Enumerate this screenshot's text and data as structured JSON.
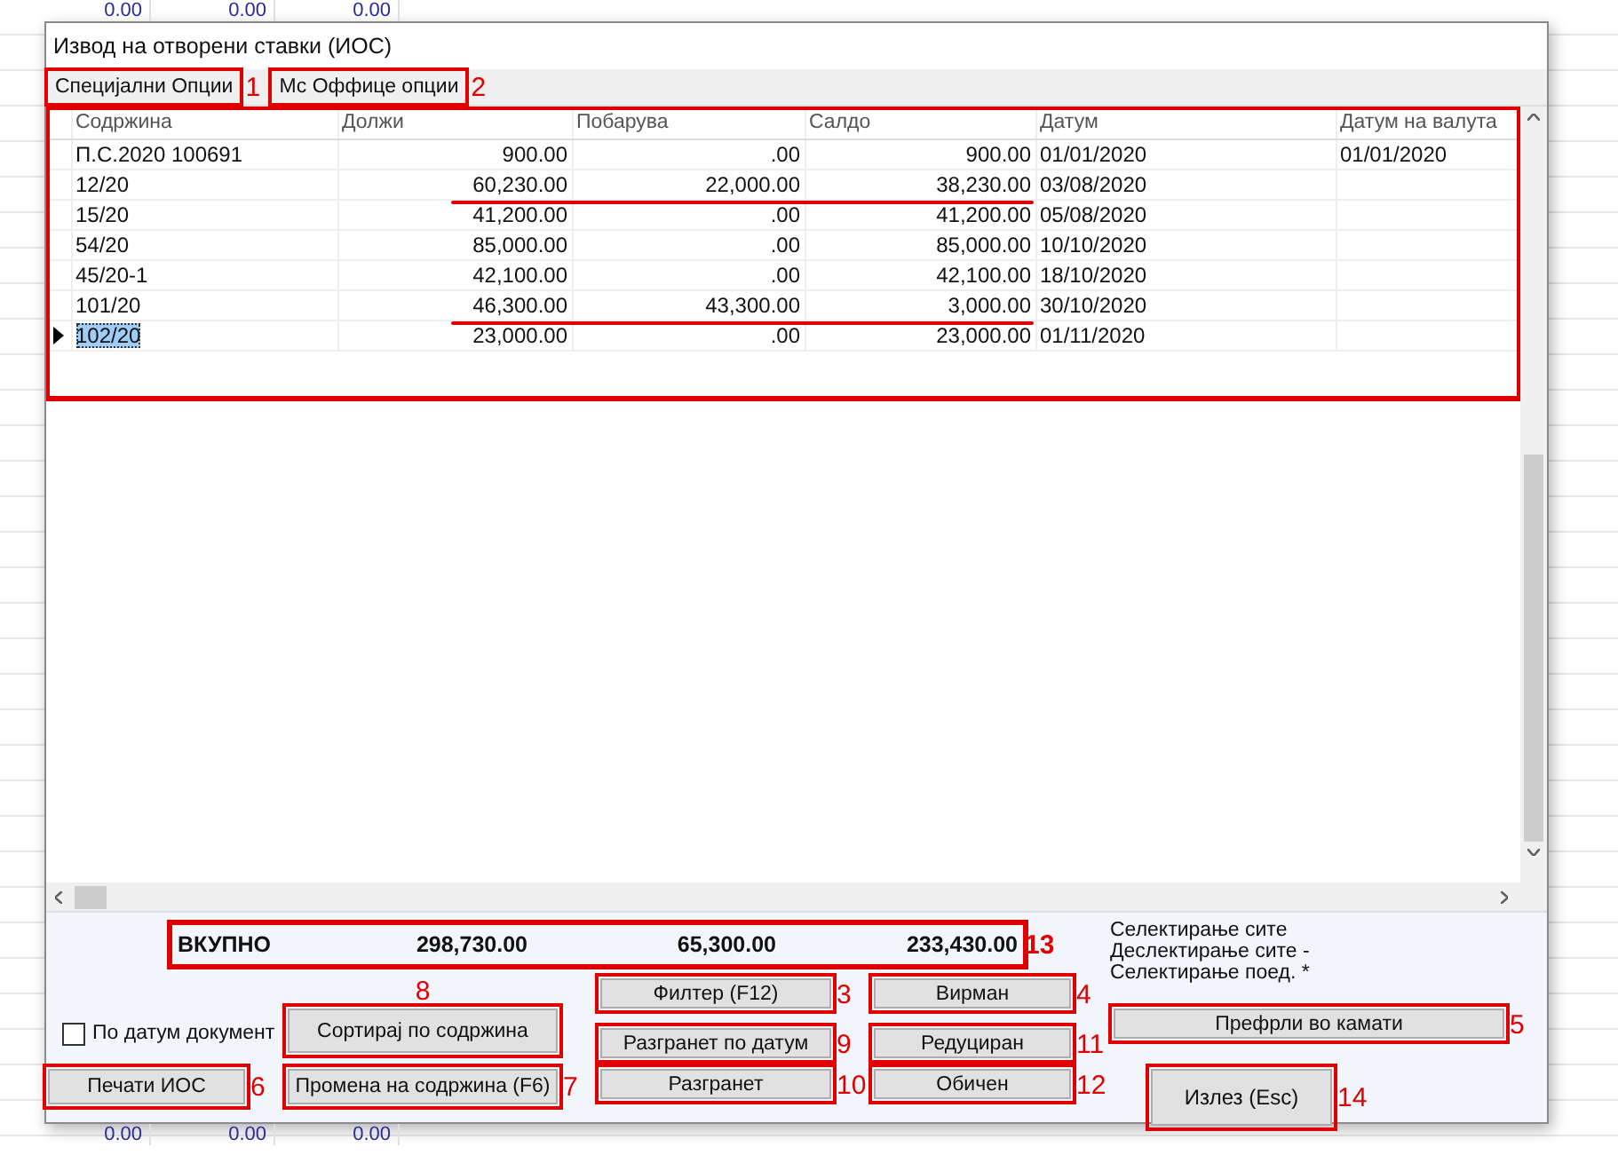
{
  "background_sheet": {
    "top_cells": [
      "0.00",
      "0.00",
      "0.00"
    ],
    "bottom_cells": [
      "0.00",
      "0.00",
      "0.00"
    ]
  },
  "window": {
    "title": "Извод на отворени ставки (ИОС)"
  },
  "menu": [
    {
      "label": "Специјални Опции",
      "annotation": "1"
    },
    {
      "label": "Мс Оффице опции",
      "annotation": "2"
    }
  ],
  "table": {
    "annotated": true,
    "columns": [
      "Содржина",
      "Должи",
      "Побарува",
      "Салдо",
      "Датум",
      "Датум на валута"
    ],
    "rows": [
      {
        "cells": [
          "П.С.2020 100691",
          "900.00",
          ".00",
          "900.00",
          "01/01/2020",
          "01/01/2020"
        ],
        "selected": false,
        "underlined": false
      },
      {
        "cells": [
          "12/20",
          "60,230.00",
          "22,000.00",
          "38,230.00",
          "03/08/2020"
        ],
        "selected": false,
        "underlined": true
      },
      {
        "cells": [
          "15/20",
          "41,200.00",
          ".00",
          "41,200.00",
          "05/08/2020"
        ],
        "selected": false,
        "underlined": false
      },
      {
        "cells": [
          "54/20",
          "85,000.00",
          ".00",
          "85,000.00",
          "10/10/2020"
        ],
        "selected": false,
        "underlined": false
      },
      {
        "cells": [
          "45/20-1",
          "42,100.00",
          ".00",
          "42,100.00",
          "18/10/2020"
        ],
        "selected": false,
        "underlined": false
      },
      {
        "cells": [
          "101/20",
          "46,300.00",
          "43,300.00",
          "3,000.00",
          "30/10/2020"
        ],
        "selected": false,
        "underlined": true
      },
      {
        "cells": [
          "102/20",
          "23,000.00",
          ".00",
          "23,000.00",
          "01/11/2020"
        ],
        "selected": true,
        "underlined": false
      }
    ]
  },
  "totals": {
    "label": "ВКУПНО",
    "values": [
      "298,730.00",
      "65,300.00",
      "233,430.00"
    ],
    "annotation": "13"
  },
  "selection_hints": [
    "Селектирање сите",
    "Деслектирање сите -",
    "Селектирање поед. *"
  ],
  "date_checkbox": {
    "label": "По датум документ",
    "checked": false
  },
  "button_rows": [
    [
      {
        "label": "Филтер (F12)",
        "annotation": "3"
      },
      {
        "label": "Вирман",
        "annotation": "4"
      }
    ],
    [
      {
        "label": "Сортирај по содржина",
        "annotation": "8"
      },
      {
        "label": "Разгранет по датум",
        "annotation": "9"
      },
      {
        "label": "Редуциран",
        "annotation": "11"
      },
      {
        "label": "Префрли во камати",
        "annotation": "5"
      }
    ],
    [
      {
        "label": "Печати ИОС",
        "annotation": "6"
      },
      {
        "label": "Промена на содржина (F6)",
        "annotation": "7"
      },
      {
        "label": "Разгранет",
        "annotation": "10"
      },
      {
        "label": "Обичен",
        "annotation": "12"
      },
      {
        "label": "Излез (Esc)",
        "annotation": "14"
      }
    ]
  ]
}
